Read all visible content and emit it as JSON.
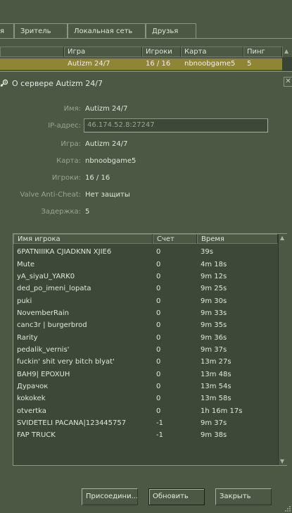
{
  "tabs": [
    "я",
    "Зритель",
    "Локальная сеть",
    "Друзья"
  ],
  "server_list": {
    "columns": [
      "",
      "Игра",
      "Игроки",
      "Карта",
      "Пинг"
    ],
    "selected_row": {
      "name": "",
      "game": "Autizm 24/7",
      "players": "16 / 16",
      "map": "nbnoobgame5",
      "ping": "5"
    },
    "scroll_up_glyph": "▲"
  },
  "dialog": {
    "title": "О сервере Autizm 24/7",
    "close_glyph": "✕",
    "info": {
      "name_label": "Имя:",
      "name_value": "Autizm 24/7",
      "ip_label": "IP-адрес:",
      "ip_value": "46.174.52.8:27247",
      "game_label": "Игра:",
      "game_value": "Autizm 24/7",
      "map_label": "Карта:",
      "map_value": "nbnoobgame5",
      "players_label": "Игроки:",
      "players_value": "16 / 16",
      "vac_label": "Valve Anti-Cheat:",
      "vac_value": "Нет защиты",
      "latency_label": "Задержка:",
      "latency_value": "5"
    },
    "players_table": {
      "columns": {
        "name": "Имя игрока",
        "score": "Счет",
        "time": "Время"
      },
      "rows": [
        {
          "name": "6PATNIIIKA CJIADKNN XJIE6",
          "score": "0",
          "time": "39s"
        },
        {
          "name": "Mute",
          "score": "0",
          "time": "4m 18s"
        },
        {
          "name": "yA_siyaU_YARK0",
          "score": "0",
          "time": "9m 12s"
        },
        {
          "name": "ded_po_imeni_lopata",
          "score": "0",
          "time": "9m 25s"
        },
        {
          "name": "puki",
          "score": "0",
          "time": "9m 30s"
        },
        {
          "name": "NovemberRain",
          "score": "0",
          "time": "9m 33s"
        },
        {
          "name": "canc3r | burgerbrod",
          "score": "0",
          "time": "9m 35s"
        },
        {
          "name": "Rarity",
          "score": "0",
          "time": "9m 36s"
        },
        {
          "name": "pedalik_vernis'",
          "score": "0",
          "time": "9m 37s"
        },
        {
          "name": "fuckin' shit very bitch blyat'",
          "score": "0",
          "time": "13m 27s"
        },
        {
          "name": "BAH9| EPOXUH",
          "score": "0",
          "time": "13m 48s"
        },
        {
          "name": "Дурачок",
          "score": "0",
          "time": "13m 54s"
        },
        {
          "name": "kokokek",
          "score": "0",
          "time": "13m 58s"
        },
        {
          "name": "otvertka",
          "score": "0",
          "time": "1h 16m 17s"
        },
        {
          "name": "SVIDETELI PACANA|123445757",
          "score": "-1",
          "time": "9m 37s"
        },
        {
          "name": "FAP TRUCK",
          "score": "-1",
          "time": "9m 38s"
        }
      ],
      "scroll_up_glyph": "▲",
      "scroll_down_glyph": "▼"
    },
    "buttons": {
      "join": "Присоедини...",
      "refresh": "Обновить",
      "close": "Закрыть"
    }
  },
  "colors": {
    "background": "#4c5844",
    "selection": "#8e8634",
    "field": "#3e4838",
    "text": "#e2e7dd",
    "label": "#9aa591"
  }
}
